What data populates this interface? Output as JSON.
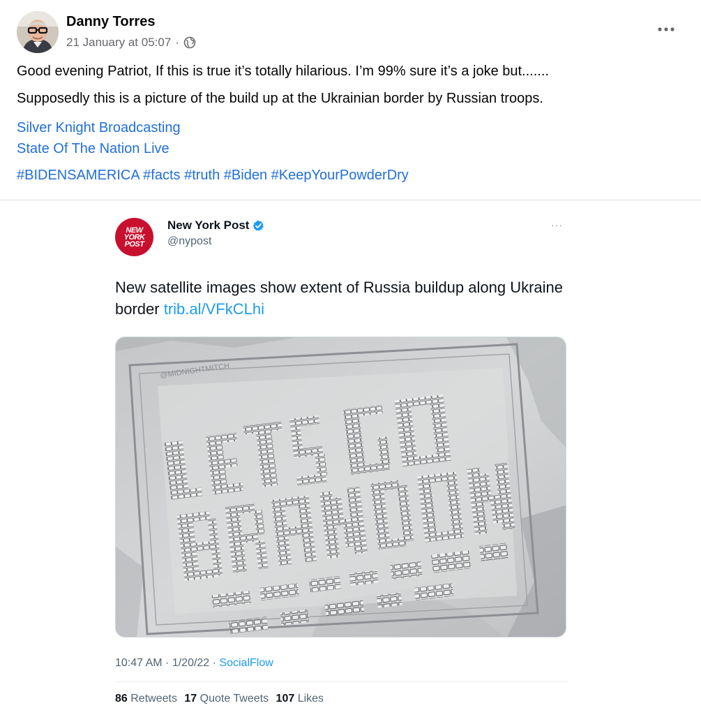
{
  "post": {
    "author": "Danny Torres",
    "timestamp": "21 January at 05:07",
    "separator": "·",
    "audience_icon": "globe-icon",
    "more_icon": "more-options-icon",
    "text_lines": [
      "Good evening Patriot, If this is true it’s totally hilarious. I’m 99% sure it’s a joke but.......",
      "Supposedly this is a picture of the build up at the Ukrainian border by Russian troops."
    ],
    "links": [
      "Silver Knight Broadcasting",
      "State Of The Nation Live"
    ],
    "hashtags": [
      "#BIDENSAMERICA",
      "#facts",
      "#truth",
      "#Biden",
      "#KeepYourPowderDry"
    ],
    "link_color": "#216fdb"
  },
  "tweet": {
    "logo_lines": [
      "NEW",
      "YORK",
      "POST"
    ],
    "name": "New York Post",
    "handle": "@nypost",
    "verified_icon": "verified-badge-icon",
    "more_label": "···",
    "text": "New satellite images show extent of Russia buildup along Ukraine border",
    "link": "trib.al/VFkCLhi",
    "image_watermark": "@MIDNIGHTMITCH",
    "image_words": [
      "LETS GO",
      "BRANDON"
    ],
    "time": "10:47 AM · 1/20/22 · ",
    "source": "SocialFlow",
    "retweets_count": "86",
    "retweets_label": "Retweets",
    "quotes_count": "17",
    "quotes_label": "Quote Tweets",
    "likes_count": "107",
    "likes_label": "Likes",
    "brand_color": "#c8102e",
    "link_color": "#1d9bf0"
  }
}
